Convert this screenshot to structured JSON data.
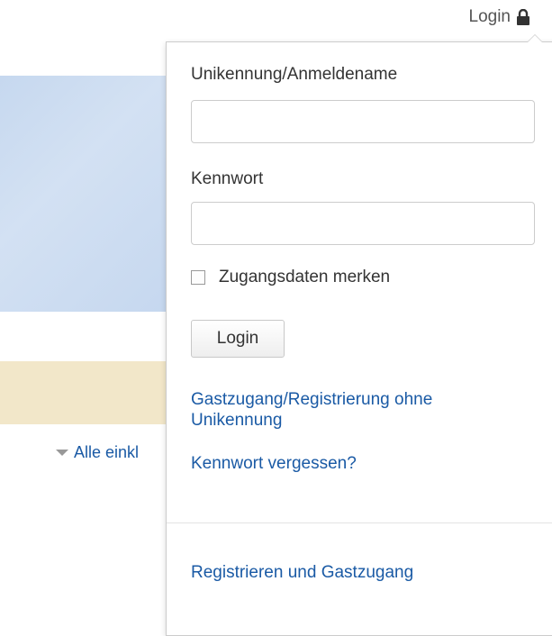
{
  "header": {
    "login_label": "Login",
    "login_icon": "lock-icon"
  },
  "background": {
    "collapse_all_label": "Alle einkl"
  },
  "login_form": {
    "username_label": "Unikennung/Anmeldename",
    "username_value": "",
    "password_label": "Kennwort",
    "password_value": "",
    "remember_label": "Zugangsdaten merken",
    "remember_checked": false,
    "submit_label": "Login",
    "guest_link_line1": "Gastzugang/Registrierung ohne",
    "guest_link_line2": "Unikennung",
    "forgot_link": "Kennwort vergessen?",
    "register_link": "Registrieren und Gastzugang"
  },
  "colors": {
    "link": "#1a5aa5",
    "hero": "#c9dbf1",
    "banner": "#f2e7c9"
  }
}
